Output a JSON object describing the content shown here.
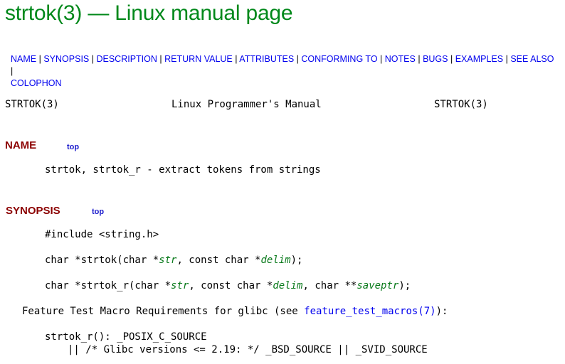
{
  "page": {
    "title": "strtok(3) — Linux manual page"
  },
  "nav": {
    "links": [
      "NAME",
      "SYNOPSIS",
      "DESCRIPTION",
      "RETURN VALUE",
      "ATTRIBUTES",
      "CONFORMING TO",
      "NOTES",
      "BUGS",
      "EXAMPLES",
      "SEE ALSO",
      "COLOPHON"
    ],
    "separator": "|"
  },
  "header": {
    "left": "STRTOK(3)",
    "center": "Linux Programmer's Manual",
    "right": "STRTOK(3)"
  },
  "name_section": {
    "heading": "NAME",
    "top_link": "top",
    "text": "strtok, strtok_r - extract tokens from strings"
  },
  "synopsis_section": {
    "heading": "SYNOPSIS",
    "top_link": "top",
    "include": "#include <string.h>",
    "proto1": {
      "pre": "char *strtok(char *",
      "arg1": "str",
      "mid": ", const char *",
      "arg2": "delim",
      "post": ");"
    },
    "proto2": {
      "pre": "char *strtok_r(char *",
      "arg1": "str",
      "mid1": ", const char *",
      "arg2": "delim",
      "mid2": ", char **",
      "arg3": "saveptr",
      "post": ");"
    },
    "feature_pre": "Feature Test Macro Requirements for glibc (see ",
    "feature_link": "feature_test_macros(7)",
    "feature_post": "):",
    "req_line1": "strtok_r(): _POSIX_C_SOURCE",
    "req_line2": "|| /* Glibc versions <= 2.19: */ _BSD_SOURCE || _SVID_SOURCE"
  }
}
